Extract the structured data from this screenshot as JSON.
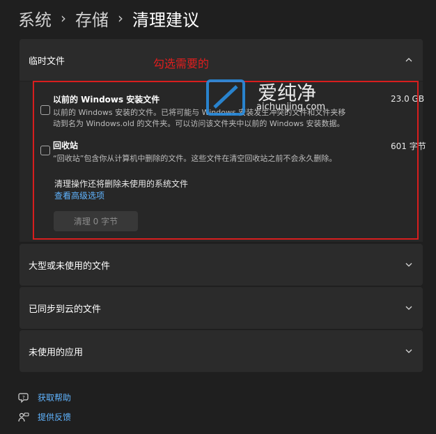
{
  "breadcrumb": {
    "items": [
      "系统",
      "存储",
      "清理建议"
    ],
    "separator": "›"
  },
  "annotation": "勾选需要的",
  "temp_files": {
    "title": "临时文件",
    "expanded": true,
    "items": [
      {
        "title": "以前的 Windows 安装文件",
        "size": "23.0 GB",
        "desc_line1": "以前的 Windows 安装的文件。已将可能与 Windows 安装发生冲突的文件和文件夹移",
        "desc_line2": "动到名为 Windows.old 的文件夹。可以访问该文件夹中以前的 Windows 安装数据。",
        "checked": false
      },
      {
        "title": "回收站",
        "size": "601 字节",
        "desc_line1": "“回收站”包含你从计算机中删除的文件。这些文件在清空回收站之前不会永久删除。",
        "checked": false
      }
    ],
    "note": "清理操作还将删除未使用的系统文件",
    "advanced_link": "查看高级选项",
    "clean_button": "清理 0 字节"
  },
  "sections": [
    {
      "title": "大型或未使用的文件"
    },
    {
      "title": "已同步到云的文件"
    },
    {
      "title": "未使用的应用"
    }
  ],
  "links": {
    "help": "获取帮助",
    "feedback": "提供反馈"
  },
  "watermark": {
    "brand": "爱纯净",
    "domain": "aichunjing.com"
  },
  "colors": {
    "background": "#1f1f1f",
    "card": "#2b2b2b",
    "accent": "#60b4ff",
    "annotation_red": "#d81e1e"
  }
}
